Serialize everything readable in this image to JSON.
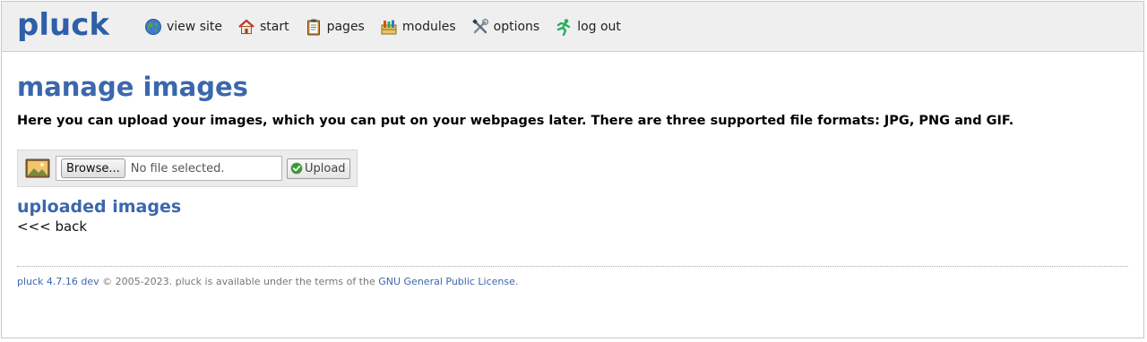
{
  "app": {
    "logo": "pluck"
  },
  "nav": [
    {
      "label": "view site",
      "icon": "globe-icon"
    },
    {
      "label": "start",
      "icon": "home-icon"
    },
    {
      "label": "pages",
      "icon": "clipboard-icon"
    },
    {
      "label": "modules",
      "icon": "modules-icon"
    },
    {
      "label": "options",
      "icon": "tools-icon"
    },
    {
      "label": "log out",
      "icon": "running-man-icon"
    }
  ],
  "main": {
    "title": "manage images",
    "intro": "Here you can upload your images, which you can put on your webpages later. There are three supported file formats: JPG, PNG and GIF.",
    "upload": {
      "browse_label": "Browse...",
      "file_status": "No file selected.",
      "upload_label": "Upload"
    },
    "uploaded_title": "uploaded images",
    "back_label": "<<< back"
  },
  "footer": {
    "version_link": "pluck 4.7.16 dev",
    "text": " © 2005-2023. pluck is available under the terms of the ",
    "license_link": "GNU General Public License",
    "end": "."
  },
  "colors": {
    "brand": "#2e5fa8",
    "heading": "#3b67ad",
    "header_bg": "#efefef"
  }
}
